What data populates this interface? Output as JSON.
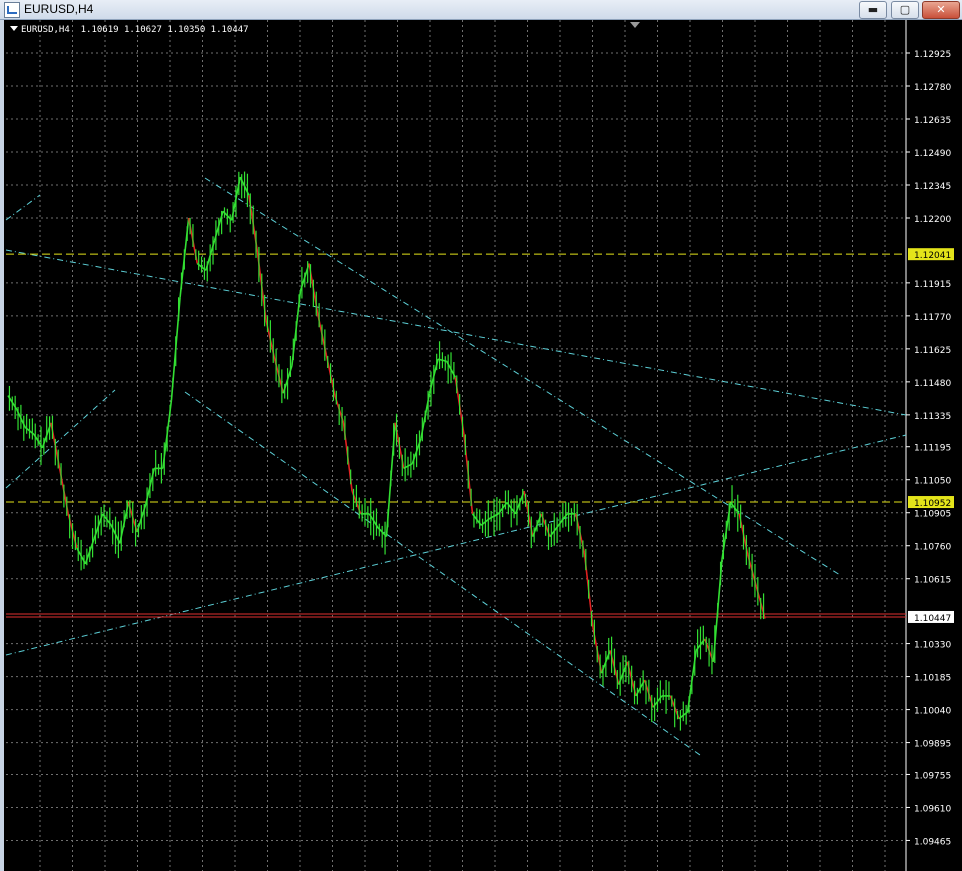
{
  "window": {
    "title": "EURUSD,H4",
    "buttons": {
      "minimize": "▬",
      "maximize": "▢",
      "close": "✕"
    }
  },
  "chart_header": {
    "symbol_tf": "EURUSD,H4",
    "ohlc": "1.10619 1.10627 1.10350 1.10447"
  },
  "colors": {
    "background": "#000000",
    "grid": "#707070",
    "bull_line": "#33e033",
    "bear_line": "#e02020",
    "trendlines": "#5ccfd6",
    "level_line": "#e4e41a",
    "bid_line": "#e03030"
  },
  "icons": {
    "app": "chart-app-icon",
    "menu": "dropdown-triangle-icon"
  },
  "chart_data": {
    "type": "line",
    "symbol": "EURUSD",
    "timeframe": "H4",
    "y_ticks": [
      "1.12925",
      "1.12780",
      "1.12635",
      "1.12490",
      "1.12345",
      "1.12200",
      "1.12041",
      "1.11915",
      "1.11770",
      "1.11625",
      "1.11480",
      "1.11335",
      "1.11195",
      "1.11050",
      "1.10952",
      "1.10905",
      "1.10760",
      "1.10615",
      "1.10447",
      "1.10330",
      "1.10185",
      "1.10040",
      "1.09895",
      "1.09755",
      "1.09610",
      "1.09465"
    ],
    "ylim": [
      1.0934,
      1.1305
    ],
    "price_labels": [
      {
        "label": "1.12041",
        "value": 1.12041,
        "color": "#e4e41a"
      },
      {
        "label": "1.10952",
        "value": 1.10952,
        "color": "#e4e41a"
      },
      {
        "label": "1.10447",
        "value": 1.10447,
        "color": "#ffffff"
      }
    ],
    "horizontal_lines": [
      {
        "value": 1.12041,
        "style": "dashed",
        "color": "#e4e41a"
      },
      {
        "value": 1.10952,
        "style": "dashed",
        "color": "#e4e41a"
      },
      {
        "value": 1.1046,
        "style": "solid",
        "color": "#e03030"
      },
      {
        "value": 1.10447,
        "style": "solid",
        "color": "#e03030"
      }
    ],
    "grid": true,
    "series": [
      {
        "values": [
          1.1142,
          1.1136,
          1.1128,
          1.1125,
          1.1119,
          1.113,
          1.111,
          1.109,
          1.1075,
          1.1068,
          1.1079,
          1.109,
          1.1085,
          1.1077,
          1.1095,
          1.1082,
          1.1094,
          1.111,
          1.111,
          1.114,
          1.1185,
          1.122,
          1.12,
          1.1197,
          1.121,
          1.1223,
          1.1219,
          1.1238,
          1.123,
          1.1205,
          1.1175,
          1.1158,
          1.1143,
          1.1155,
          1.1188,
          1.12,
          1.1178,
          1.116,
          1.1142,
          1.113,
          1.11,
          1.109,
          1.109,
          1.1084,
          1.108,
          1.113,
          1.111,
          1.1112,
          1.1123,
          1.1143,
          1.1158,
          1.1157,
          1.115,
          1.1125,
          1.109,
          1.1085,
          1.1088,
          1.109,
          1.1095,
          1.109,
          1.11,
          1.108,
          1.109,
          1.108,
          1.1085,
          1.109,
          1.109,
          1.1073,
          1.104,
          1.102,
          1.103,
          1.1015,
          1.1025,
          1.101,
          1.1017,
          1.1005,
          1.101,
          1.101,
          1.1,
          1.1003,
          1.103,
          1.1035,
          1.1025,
          1.107,
          1.1095,
          1.109,
          1.1072,
          1.1058,
          1.1044
        ],
        "color": "#33e033"
      }
    ]
  }
}
